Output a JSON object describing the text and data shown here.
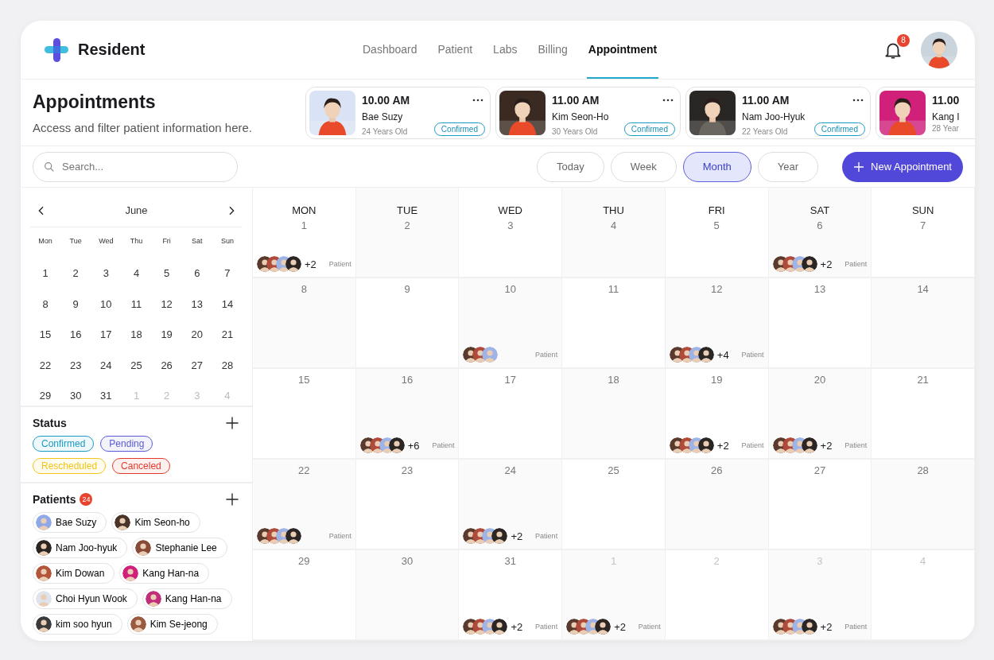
{
  "app": {
    "name": "Resident"
  },
  "nav": [
    {
      "label": "Dashboard",
      "selected": false
    },
    {
      "label": "Patient",
      "selected": false
    },
    {
      "label": "Labs",
      "selected": false
    },
    {
      "label": "Billing",
      "selected": false
    },
    {
      "label": "Appointment",
      "selected": true
    }
  ],
  "notifications": {
    "count": "8"
  },
  "page": {
    "title": "Appointments",
    "subtitle": "Access and filter patient information here."
  },
  "appointment_cards": [
    {
      "time": "10.00 AM",
      "name": "Bae Suzy",
      "age": "24 Years Old",
      "status": "Confirmed",
      "color": "#d9e3f5"
    },
    {
      "time": "11.00 AM",
      "name": "Kim Seon-Ho",
      "age": "30 Years Old",
      "status": "Confirmed",
      "color": "#3a2a22"
    },
    {
      "time": "11.00 AM",
      "name": "Nam Joo-Hyuk",
      "age": "22 Years Old",
      "status": "Confirmed",
      "color": "#2a2624"
    },
    {
      "time": "11.00",
      "name": "Kang I",
      "age": "28 Year",
      "color": "#d0207a"
    }
  ],
  "search": {
    "placeholder": "Search..."
  },
  "view_tabs": [
    {
      "label": "Today",
      "selected": false
    },
    {
      "label": "Week",
      "selected": false
    },
    {
      "label": "Month",
      "selected": true
    },
    {
      "label": "Year",
      "selected": false
    }
  ],
  "new_button": {
    "label": "New Appointment"
  },
  "mini_calendar": {
    "month": "June",
    "weekdays": [
      "Mon",
      "Tue",
      "Wed",
      "Thu",
      "Fri",
      "Sat",
      "Sun"
    ],
    "days": [
      {
        "label": "1",
        "muted": false
      },
      {
        "label": "2",
        "muted": false
      },
      {
        "label": "3",
        "muted": false
      },
      {
        "label": "4",
        "muted": false
      },
      {
        "label": "5",
        "muted": false
      },
      {
        "label": "6",
        "muted": false
      },
      {
        "label": "7",
        "muted": false
      },
      {
        "label": "8",
        "muted": false
      },
      {
        "label": "9",
        "muted": false
      },
      {
        "label": "10",
        "muted": false
      },
      {
        "label": "11",
        "muted": false
      },
      {
        "label": "12",
        "muted": false
      },
      {
        "label": "13",
        "muted": false
      },
      {
        "label": "14",
        "muted": false
      },
      {
        "label": "15",
        "muted": false
      },
      {
        "label": "16",
        "muted": false
      },
      {
        "label": "17",
        "muted": false
      },
      {
        "label": "18",
        "muted": false
      },
      {
        "label": "19",
        "muted": false
      },
      {
        "label": "20",
        "muted": false
      },
      {
        "label": "21",
        "muted": false
      },
      {
        "label": "22",
        "muted": false
      },
      {
        "label": "23",
        "muted": false
      },
      {
        "label": "24",
        "muted": false
      },
      {
        "label": "25",
        "muted": false
      },
      {
        "label": "26",
        "muted": false
      },
      {
        "label": "27",
        "muted": false
      },
      {
        "label": "28",
        "muted": false
      },
      {
        "label": "29",
        "muted": false
      },
      {
        "label": "30",
        "muted": false
      },
      {
        "label": "31",
        "muted": false
      },
      {
        "label": "1",
        "muted": true
      },
      {
        "label": "2",
        "muted": true
      },
      {
        "label": "3",
        "muted": true
      },
      {
        "label": "4",
        "muted": true
      }
    ]
  },
  "status_filter": {
    "title": "Status",
    "tags": [
      {
        "label": "Confirmed",
        "color": "#1a9bc4"
      },
      {
        "label": "Pending",
        "color": "#5a5ad6"
      },
      {
        "label": "Rescheduled",
        "color": "#f2c418"
      },
      {
        "label": "Canceled",
        "color": "#e23b2e"
      }
    ]
  },
  "patients": {
    "title": "Patients",
    "count": "24",
    "items": [
      {
        "name": "Bae Suzy",
        "color": "#8fa9e8"
      },
      {
        "name": "Kim Seon-ho",
        "color": "#4a3428"
      },
      {
        "name": "Nam Joo-hyuk",
        "color": "#2b2522"
      },
      {
        "name": "Stephanie Lee",
        "color": "#8a4a38"
      },
      {
        "name": "Kim Dowan",
        "color": "#b4553a"
      },
      {
        "name": "Kang Han-na",
        "color": "#d0207a"
      },
      {
        "name": "Choi Hyun Wook",
        "color": "#dfe4ec"
      },
      {
        "name": "Kang Han-na",
        "color": "#c0307a"
      },
      {
        "name": "kim soo hyun",
        "color": "#3a3a3a"
      },
      {
        "name": "Kim Se-jeong",
        "color": "#9a5a40"
      }
    ]
  },
  "calendar": {
    "weekdays": [
      "MON",
      "TUE",
      "WED",
      "THU",
      "FRI",
      "SAT",
      "SUN"
    ],
    "weeks": [
      [
        {
          "day": "1",
          "muted": false,
          "event": {
            "avatars": [
              {
                "kind": "avatar"
              },
              {
                "kind": "avatar"
              },
              {
                "kind": "avatar"
              },
              {
                "kind": "avatar"
              }
            ],
            "more": "+2",
            "label": "Patient"
          }
        },
        {
          "day": "2",
          "muted": false
        },
        {
          "day": "3",
          "muted": false
        },
        {
          "day": "4",
          "muted": false
        },
        {
          "day": "5",
          "muted": false
        },
        {
          "day": "6",
          "muted": false,
          "event": {
            "avatars": [
              {
                "kind": "avatar"
              },
              {
                "kind": "avatar"
              },
              {
                "kind": "avatar"
              },
              {
                "kind": "avatar"
              }
            ],
            "more": "+2",
            "label": "Patient"
          }
        },
        {
          "day": "7",
          "muted": false
        }
      ],
      [
        {
          "day": "8",
          "muted": false
        },
        {
          "day": "9",
          "muted": false
        },
        {
          "day": "10",
          "muted": false,
          "event": {
            "avatars": [
              {
                "kind": "avatar"
              },
              {
                "kind": "avatar"
              },
              {
                "kind": "avatar"
              }
            ],
            "label": "Patient"
          }
        },
        {
          "day": "11",
          "muted": false
        },
        {
          "day": "12",
          "muted": false,
          "event": {
            "avatars": [
              {
                "kind": "avatar"
              },
              {
                "kind": "avatar"
              },
              {
                "kind": "avatar"
              },
              {
                "kind": "avatar"
              }
            ],
            "more": "+4",
            "label": "Patient"
          }
        },
        {
          "day": "13",
          "muted": false
        },
        {
          "day": "14",
          "muted": false
        }
      ],
      [
        {
          "day": "15",
          "muted": false
        },
        {
          "day": "16",
          "muted": false,
          "event": {
            "avatars": [
              {
                "kind": "avatar"
              },
              {
                "kind": "avatar"
              },
              {
                "kind": "avatar"
              },
              {
                "kind": "avatar"
              }
            ],
            "more": "+6",
            "label": "Patient"
          }
        },
        {
          "day": "17",
          "muted": false
        },
        {
          "day": "18",
          "muted": false
        },
        {
          "day": "19",
          "muted": false,
          "event": {
            "avatars": [
              {
                "kind": "avatar"
              },
              {
                "kind": "avatar"
              },
              {
                "kind": "avatar"
              },
              {
                "kind": "avatar"
              }
            ],
            "more": "+2",
            "label": "Patient"
          }
        },
        {
          "day": "20",
          "muted": false,
          "event": {
            "avatars": [
              {
                "kind": "avatar"
              },
              {
                "kind": "avatar"
              },
              {
                "kind": "avatar"
              },
              {
                "kind": "avatar"
              }
            ],
            "more": "+2",
            "label": "Patient"
          }
        },
        {
          "day": "21",
          "muted": false
        }
      ],
      [
        {
          "day": "22",
          "muted": false,
          "event": {
            "avatars": [
              {
                "kind": "avatar"
              },
              {
                "kind": "avatar"
              },
              {
                "kind": "avatar"
              },
              {
                "kind": "avatar"
              }
            ],
            "label": "Patient"
          }
        },
        {
          "day": "23",
          "muted": false
        },
        {
          "day": "24",
          "muted": false,
          "event": {
            "avatars": [
              {
                "kind": "avatar"
              },
              {
                "kind": "avatar"
              },
              {
                "kind": "avatar"
              },
              {
                "kind": "avatar"
              }
            ],
            "more": "+2",
            "label": "Patient"
          }
        },
        {
          "day": "25",
          "muted": false
        },
        {
          "day": "26",
          "muted": false
        },
        {
          "day": "27",
          "muted": false
        },
        {
          "day": "28",
          "muted": false
        }
      ],
      [
        {
          "day": "29",
          "muted": false
        },
        {
          "day": "30",
          "muted": false
        },
        {
          "day": "31",
          "muted": false,
          "event": {
            "avatars": [
              {
                "kind": "avatar"
              },
              {
                "kind": "avatar"
              },
              {
                "kind": "avatar"
              },
              {
                "kind": "avatar"
              }
            ],
            "more": "+2",
            "label": "Patient"
          }
        },
        {
          "day": "1",
          "muted": true,
          "event": {
            "avatars": [
              {
                "kind": "avatar"
              },
              {
                "kind": "avatar"
              },
              {
                "kind": "avatar"
              },
              {
                "kind": "avatar"
              }
            ],
            "more": "+2",
            "label": "Patient"
          }
        },
        {
          "day": "2",
          "muted": true
        },
        {
          "day": "3",
          "muted": true,
          "event": {
            "avatars": [
              {
                "kind": "avatar"
              },
              {
                "kind": "avatar"
              },
              {
                "kind": "avatar"
              },
              {
                "kind": "avatar"
              }
            ],
            "more": "+2",
            "label": "Patient"
          }
        },
        {
          "day": "4",
          "muted": true
        }
      ]
    ]
  }
}
